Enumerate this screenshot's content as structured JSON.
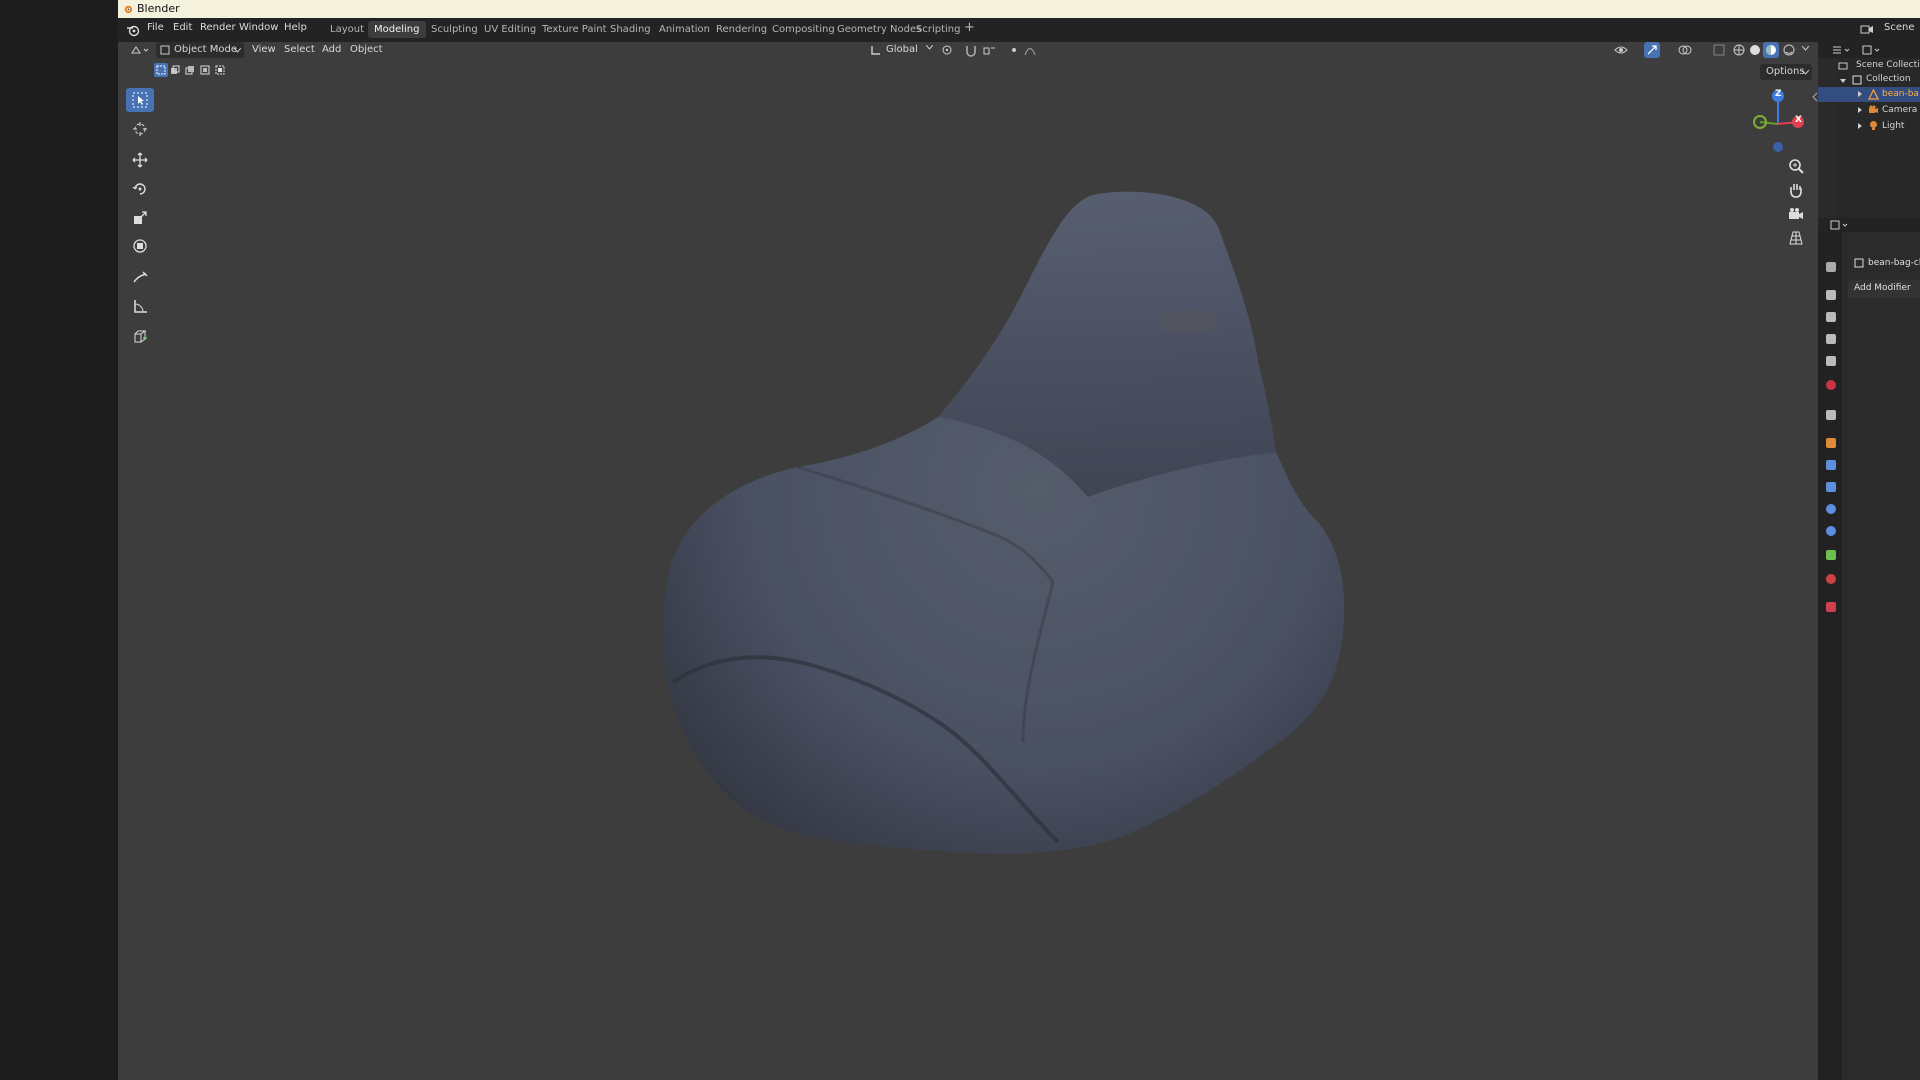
{
  "titlebar": {
    "title": "Blender"
  },
  "menu": {
    "file": "File",
    "edit": "Edit",
    "render": "Render",
    "window": "Window",
    "help": "Help"
  },
  "workspaces": [
    "Layout",
    "Modeling",
    "Sculpting",
    "UV Editing",
    "Texture Paint",
    "Shading",
    "Animation",
    "Rendering",
    "Compositing",
    "Geometry Nodes",
    "Scripting"
  ],
  "active_workspace": "Modeling",
  "add_tab": "+",
  "scene_label": "Scene",
  "viewport_header": {
    "mode": "Object Mode",
    "view": "View",
    "select": "Select",
    "add": "Add",
    "object": "Object",
    "orientation": "Global",
    "options": "Options"
  },
  "gizmo": {
    "z": "Z",
    "x": "X",
    "y": "Y"
  },
  "outliner": {
    "scene_collection": "Scene Collection",
    "collection": "Collection",
    "items": [
      "bean-ba",
      "Camera",
      "Light"
    ]
  },
  "properties": {
    "object_name": "bean-bag-ch",
    "add_modifier": "Add Modifier"
  },
  "colors": {
    "accent": "#4772b3",
    "object_fill": "#4b5366",
    "viewport_bg": "#3d3d3d"
  }
}
